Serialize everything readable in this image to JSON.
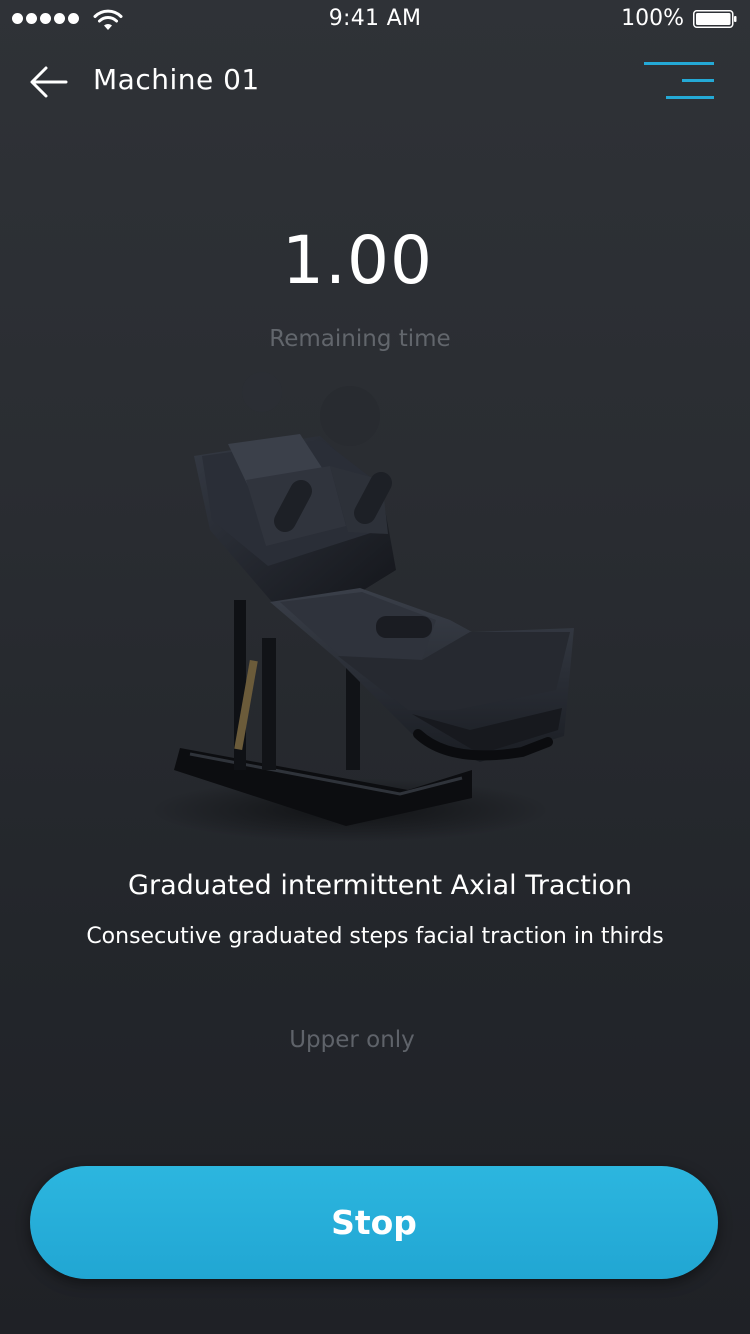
{
  "status_bar": {
    "time": "9:41 AM",
    "battery": "100%"
  },
  "nav": {
    "title": "Machine 01"
  },
  "timer": {
    "value": "1.00",
    "label": "Remaining time"
  },
  "program": {
    "title": "Graduated intermittent Axial Traction",
    "description": "Consecutive graduated steps facial traction in thirds",
    "mode": "Upper only"
  },
  "actions": {
    "stop_label": "Stop"
  },
  "colors": {
    "accent": "#24a9d6",
    "background": "#2a2d32",
    "muted_text": "#62666c"
  }
}
